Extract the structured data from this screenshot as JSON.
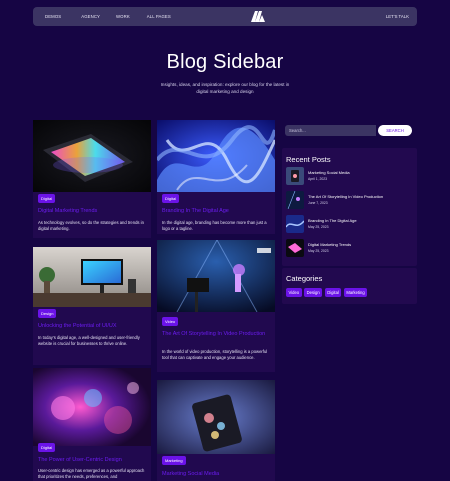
{
  "nav": {
    "links": [
      "DEMOS",
      "AGENCY",
      "WORK",
      "ALL PAGES"
    ],
    "cta": "LET'S TALK",
    "logo": "m-logo-icon"
  },
  "hero": {
    "title": "Blog Sidebar",
    "subtitle": "Insights, ideas, and inspiration: explore our blog for the latest in digital marketing and design"
  },
  "posts": [
    {
      "badge": "Digital",
      "title": "Digital Marketing Trends",
      "desc": "As technology evolves, so do the strategies and trends in digital marketing."
    },
    {
      "badge": "Digital",
      "title": "Branding In The Digital Age",
      "desc": "In the digital age, branding has become more than just a logo or a tagline."
    },
    {
      "badge": "Design",
      "title": "Unlocking the Potential of UI/UX",
      "desc": "In today's digital age, a well-designed and user-friendly website is crucial for businesses to thrive online."
    },
    {
      "badge": "Video",
      "title": "The Art Of Storytelling In Video Production",
      "desc": "In the world of video production, storytelling is a powerful tool that can captivate and engage your audience."
    },
    {
      "badge": "Digital",
      "title": "The Power of User-Centric Design",
      "desc": "User-centric design has emerged as a powerful approach that prioritizes the needs, preferences, and"
    },
    {
      "badge": "Marketing",
      "title": "Marketing Social Media",
      "desc": ""
    }
  ],
  "search": {
    "placeholder": "Search...",
    "button": "SEARCH"
  },
  "recent": {
    "title": "Recent Posts",
    "items": [
      {
        "title": "Marketing Social Media",
        "date": "April 1, 2023"
      },
      {
        "title": "The Art Of Storytelling In Video Production",
        "date": "June 7, 2023"
      },
      {
        "title": "Branding In The Digital Age",
        "date": "May 25, 2023"
      },
      {
        "title": "Digital Marketing Trends",
        "date": "May 25, 2023"
      }
    ]
  },
  "categories": {
    "title": "Categories",
    "tags": [
      "Video",
      "Design",
      "Digital",
      "Marketing"
    ]
  },
  "colors": {
    "background": "#160544",
    "accent": "#6b13e8",
    "nav": "#3b3463",
    "card": "#21094f"
  }
}
